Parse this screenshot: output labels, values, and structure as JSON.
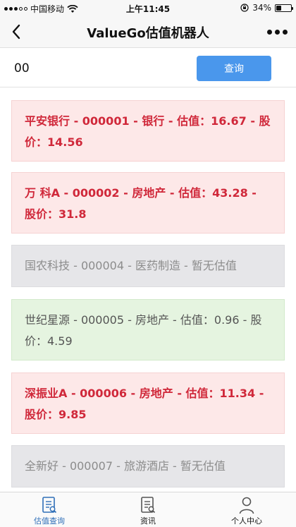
{
  "status_bar": {
    "carrier": "中国移动",
    "time": "上午11:45",
    "battery": "34%",
    "battery_level": 0.34
  },
  "nav": {
    "title": "ValueGo估值机器人",
    "back_icon": "chevron-left-icon",
    "more_icon": "more-dots-icon"
  },
  "search": {
    "value": "00",
    "button_label": "查询"
  },
  "results": [
    {
      "style": "red",
      "text": "平安银行 - 000001 - 银行 - 估值：16.67 - 股价：14.56"
    },
    {
      "style": "red",
      "text": "万 科A - 000002 - 房地产 - 估值：43.28 - 股价：31.8"
    },
    {
      "style": "gray",
      "text": "国农科技 - 000004 - 医药制造 - 暂无估值"
    },
    {
      "style": "green",
      "text": "世纪星源 - 000005 - 房地产 - 估值：0.96 - 股价：4.59"
    },
    {
      "style": "red",
      "text": "深振业A - 000006 - 房地产 - 估值：11.34 - 股价：9.85"
    },
    {
      "style": "gray",
      "text": "全新好 - 000007 - 旅游酒店 - 暂无估值"
    }
  ],
  "tabs": [
    {
      "label": "估值查询",
      "icon": "valuation-doc-icon",
      "active": true
    },
    {
      "label": "资讯",
      "icon": "news-doc-icon",
      "active": false
    },
    {
      "label": "个人中心",
      "icon": "user-icon",
      "active": false
    }
  ],
  "colors": {
    "accent": "#4a97ec",
    "overvalued_bg": "#fde8e8",
    "overvalued_text": "#d0283a",
    "undervalued_bg": "#e5f4e0",
    "no_value_bg": "#e6e6e9",
    "active_tab": "#2f6fb8"
  }
}
